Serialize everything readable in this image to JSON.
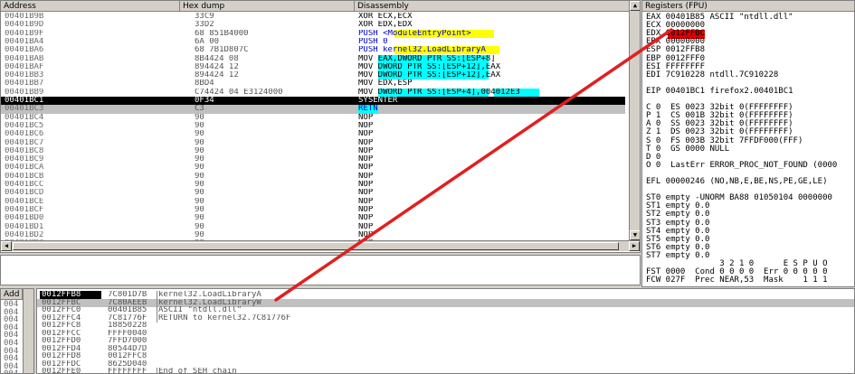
{
  "disasm": {
    "headers": {
      "address": "Address",
      "hex": "Hex dump",
      "disasm": "Disassembly"
    },
    "rows": [
      {
        "addr": "00401B9B",
        "hex": "33C9",
        "ins": "XOR ECX,ECX"
      },
      {
        "addr": "00401B9D",
        "hex": "33D2",
        "ins": "XOR EDX,EDX"
      },
      {
        "addr": "00401B9F",
        "hex": "68 851B4000",
        "ins": "PUSH <ModuleEntryPoint>"
      },
      {
        "addr": "00401BA4",
        "hex": "6A 00",
        "ins": "PUSH 0"
      },
      {
        "addr": "00401BA6",
        "hex": "68 7B1D807C",
        "ins": "PUSH kernel32.LoadLibraryA"
      },
      {
        "addr": "00401BAB",
        "hex": "8B4424 08",
        "ins": "MOV EAX,DWORD PTR SS:[ESP+8]"
      },
      {
        "addr": "00401BAF",
        "hex": "894424 12",
        "ins": "MOV DWORD PTR SS:[ESP+12],EAX"
      },
      {
        "addr": "00401BB3",
        "hex": "894424 12",
        "ins": "MOV DWORD PTR SS:[ESP+12],EAX"
      },
      {
        "addr": "00401BB7",
        "hex": "8BD4",
        "ins": "MOV EDX,ESP"
      },
      {
        "addr": "00401BB9",
        "hex": "C74424 04 E3124000",
        "ins": "MOV DWORD PTR SS:[ESP+4],004012E3"
      },
      {
        "addr": "00401BC1",
        "hex": "0F34",
        "ins": "SYSENTER"
      },
      {
        "addr": "00401BC3",
        "hex": "C3",
        "ins": "RETN"
      },
      {
        "addr": "00401BC4",
        "hex": "90",
        "ins": "NOP"
      },
      {
        "addr": "00401BC5",
        "hex": "90",
        "ins": "NOP"
      },
      {
        "addr": "00401BC6",
        "hex": "90",
        "ins": "NOP"
      },
      {
        "addr": "00401BC7",
        "hex": "90",
        "ins": "NOP"
      },
      {
        "addr": "00401BC8",
        "hex": "90",
        "ins": "NOP"
      },
      {
        "addr": "00401BC9",
        "hex": "90",
        "ins": "NOP"
      },
      {
        "addr": "00401BCA",
        "hex": "90",
        "ins": "NOP"
      },
      {
        "addr": "00401BCB",
        "hex": "90",
        "ins": "NOP"
      },
      {
        "addr": "00401BCC",
        "hex": "90",
        "ins": "NOP"
      },
      {
        "addr": "00401BCD",
        "hex": "90",
        "ins": "NOP"
      },
      {
        "addr": "00401BCE",
        "hex": "90",
        "ins": "NOP"
      },
      {
        "addr": "00401BCF",
        "hex": "90",
        "ins": "NOP"
      },
      {
        "addr": "00401BD0",
        "hex": "90",
        "ins": "NOP"
      },
      {
        "addr": "00401BD1",
        "hex": "90",
        "ins": "NOP"
      },
      {
        "addr": "00401BD2",
        "hex": "90",
        "ins": "NOP"
      },
      {
        "addr": "00401BD3",
        "hex": "90",
        "ins": "NOP"
      }
    ]
  },
  "registers": {
    "title": "Registers (FPU)",
    "lines": [
      "EAX 00401B85 ASCII \"ntdll.dll\"",
      "ECX 00000000",
      "EDX 0012FFBC",
      "EBX 00000000",
      "ESP 0012FFB8",
      "EBP 0012FFF0",
      "ESI FFFFFFFF",
      "EDI 7C910228 ntdll.7C910228",
      "",
      "EIP 00401BC1 firefox2.00401BC1",
      "",
      "C 0  ES 0023 32bit 0(FFFFFFFF)",
      "P 1  CS 001B 32bit 0(FFFFFFFF)",
      "A 0  SS 0023 32bit 0(FFFFFFFF)",
      "Z 1  DS 0023 32bit 0(FFFFFFFF)",
      "S 0  FS 003B 32bit 7FFDF000(FFF)",
      "T 0  GS 0000 NULL",
      "D 0",
      "O 0  LastErr ERROR_PROC_NOT_FOUND (0000",
      "",
      "EFL 00000246 (NO,NB,E,BE,NS,PE,GE,LE)",
      "",
      "ST0 empty -UNORM BA88 01050104 0000000",
      "ST1 empty 0.0",
      "ST2 empty 0.0",
      "ST3 empty 0.0",
      "ST4 empty 0.0",
      "ST5 empty 0.0",
      "ST6 empty 0.0",
      "ST7 empty 0.0",
      "               3 2 1 0      E S P U O",
      "FST 0000  Cond 0 0 0 0  Err 0 0 0 0 0",
      "FCW 027F  Prec NEAR,53  Mask    1 1 1"
    ]
  },
  "dump": {
    "header": "Add",
    "rows": [
      "004",
      "004",
      "004",
      "004",
      "004",
      "004",
      "004",
      "004",
      "004",
      "004"
    ]
  },
  "stack": {
    "rows": [
      {
        "addr": "0012FFB8",
        "val": "7C801D7B",
        "comment": "kernel32.LoadLibraryA"
      },
      {
        "addr": "0012FFBC",
        "val": "7C80AEEB",
        "comment": "kernel32.LoadLibraryW"
      },
      {
        "addr": "0012FFC0",
        "val": "00401B85",
        "comment": "ASCII \"ntdll.dll\""
      },
      {
        "addr": "0012FFC4",
        "val": "7C81776F",
        "comment": "RETURN to kernel32.7C81776F"
      },
      {
        "addr": "0012FFC8",
        "val": "18850228",
        "comment": ""
      },
      {
        "addr": "0012FFCC",
        "val": "FFFF0040",
        "comment": ""
      },
      {
        "addr": "0012FFD0",
        "val": "7FFD7000",
        "comment": ""
      },
      {
        "addr": "0012FFD4",
        "val": "80544D7D",
        "comment": ""
      },
      {
        "addr": "0012FFD8",
        "val": "0012FFC8",
        "comment": ""
      },
      {
        "addr": "0012FFDC",
        "val": "8625D040",
        "comment": ""
      },
      {
        "addr": "0012FFE0",
        "val": "FFFFFFFF",
        "comment": "End of SEH chain"
      }
    ]
  },
  "colors": {
    "annotation_line": "#e02020",
    "selection": "#000000",
    "cyan_highlight": "#00ffff",
    "yellow_highlight": "#ffff00"
  }
}
